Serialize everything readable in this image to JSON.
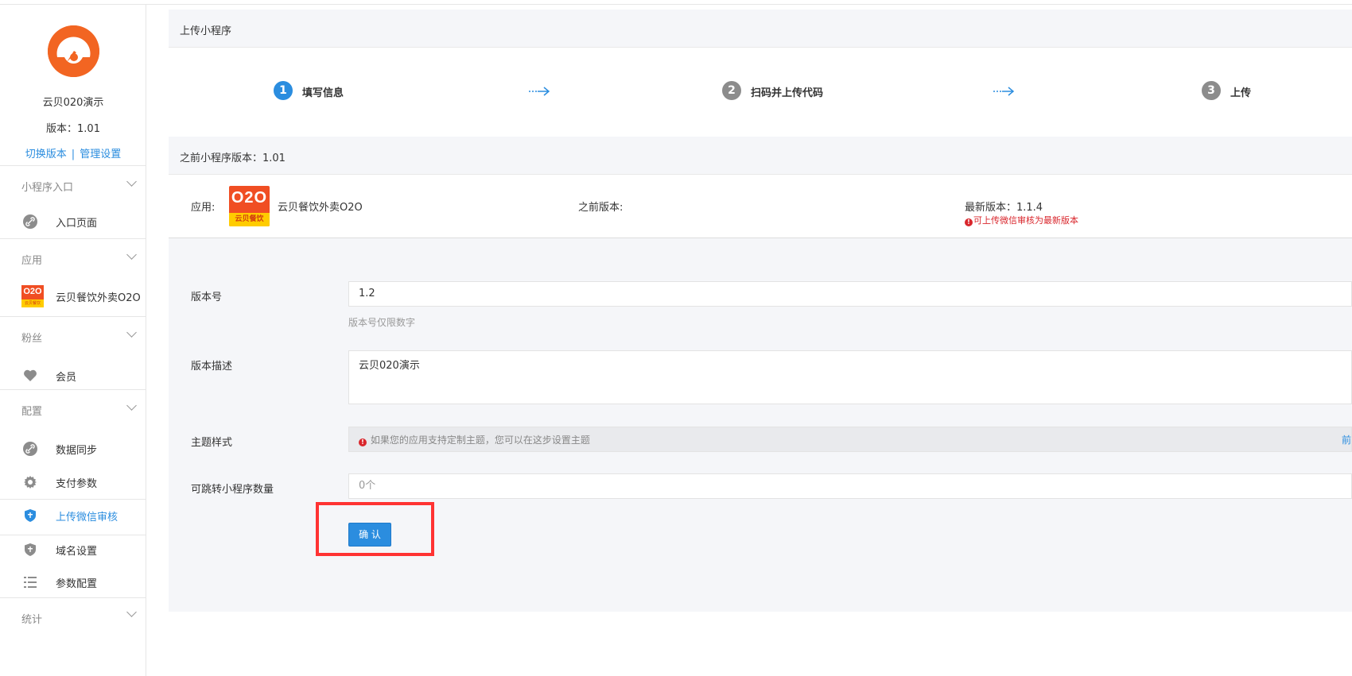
{
  "sidebar": {
    "app_name": "云贝020演示",
    "version": "版本：1.01",
    "links": {
      "switch_version": "切换版本",
      "separator": "|",
      "manage_settings": "管理设置"
    },
    "sections": [
      {
        "title": "小程序入口",
        "items": [
          {
            "label": "入口页面",
            "icon": "link-icon"
          }
        ]
      },
      {
        "title": "应用",
        "items": [
          {
            "label": "云贝餐饮外卖O2O",
            "icon": "o2o-app-icon"
          }
        ]
      },
      {
        "title": "粉丝",
        "items": [
          {
            "label": "会员",
            "icon": "heart-icon"
          }
        ]
      },
      {
        "title": "配置",
        "items": [
          {
            "label": "数据同步",
            "icon": "link-icon"
          },
          {
            "label": "支付参数",
            "icon": "gear-icon"
          },
          {
            "label": "上传微信审核",
            "icon": "shield-icon",
            "active": true
          },
          {
            "label": "域名设置",
            "icon": "shield-icon"
          },
          {
            "label": "参数配置",
            "icon": "list-icon"
          }
        ]
      },
      {
        "title": "统计",
        "items": []
      }
    ],
    "mini_logo_text": "O2O",
    "mini_logo_band": "云贝餐饮"
  },
  "main": {
    "panel_title": "上传小程序",
    "steps": [
      {
        "num": "1",
        "label": "填写信息",
        "active": true
      },
      {
        "num": "2",
        "label": "扫码并上传代码",
        "active": false
      },
      {
        "num": "3",
        "label": "上传",
        "active": false
      }
    ],
    "prev_version_title": "之前小程序版本：1.01",
    "app_row": {
      "app_label": "应用:",
      "logo_text": "O2O",
      "logo_band": "云贝餐饮",
      "app_name": "云贝餐饮外卖O2O",
      "prev_version_label": "之前版本:",
      "latest_version": "最新版本：1.1.4",
      "warning": "可上传微信审核为最新版本",
      "warning_icon": "!"
    },
    "form": {
      "version_label": "版本号",
      "version_value": "1.2",
      "version_hint": "版本号仅限数字",
      "desc_label": "版本描述",
      "desc_value": "云贝020演示",
      "theme_label": "主题样式",
      "theme_icon": "!",
      "theme_message": "如果您的应用支持定制主题，您可以在这步设置主题",
      "theme_more": "前",
      "jump_label": "可跳转小程序数量",
      "jump_value": "0个",
      "confirm_label": "确 认"
    }
  },
  "colors": {
    "accent": "#2b8ddf",
    "brand_orange": "#f26522",
    "warning_red": "#d9262c",
    "highlight": "#ff3333"
  }
}
